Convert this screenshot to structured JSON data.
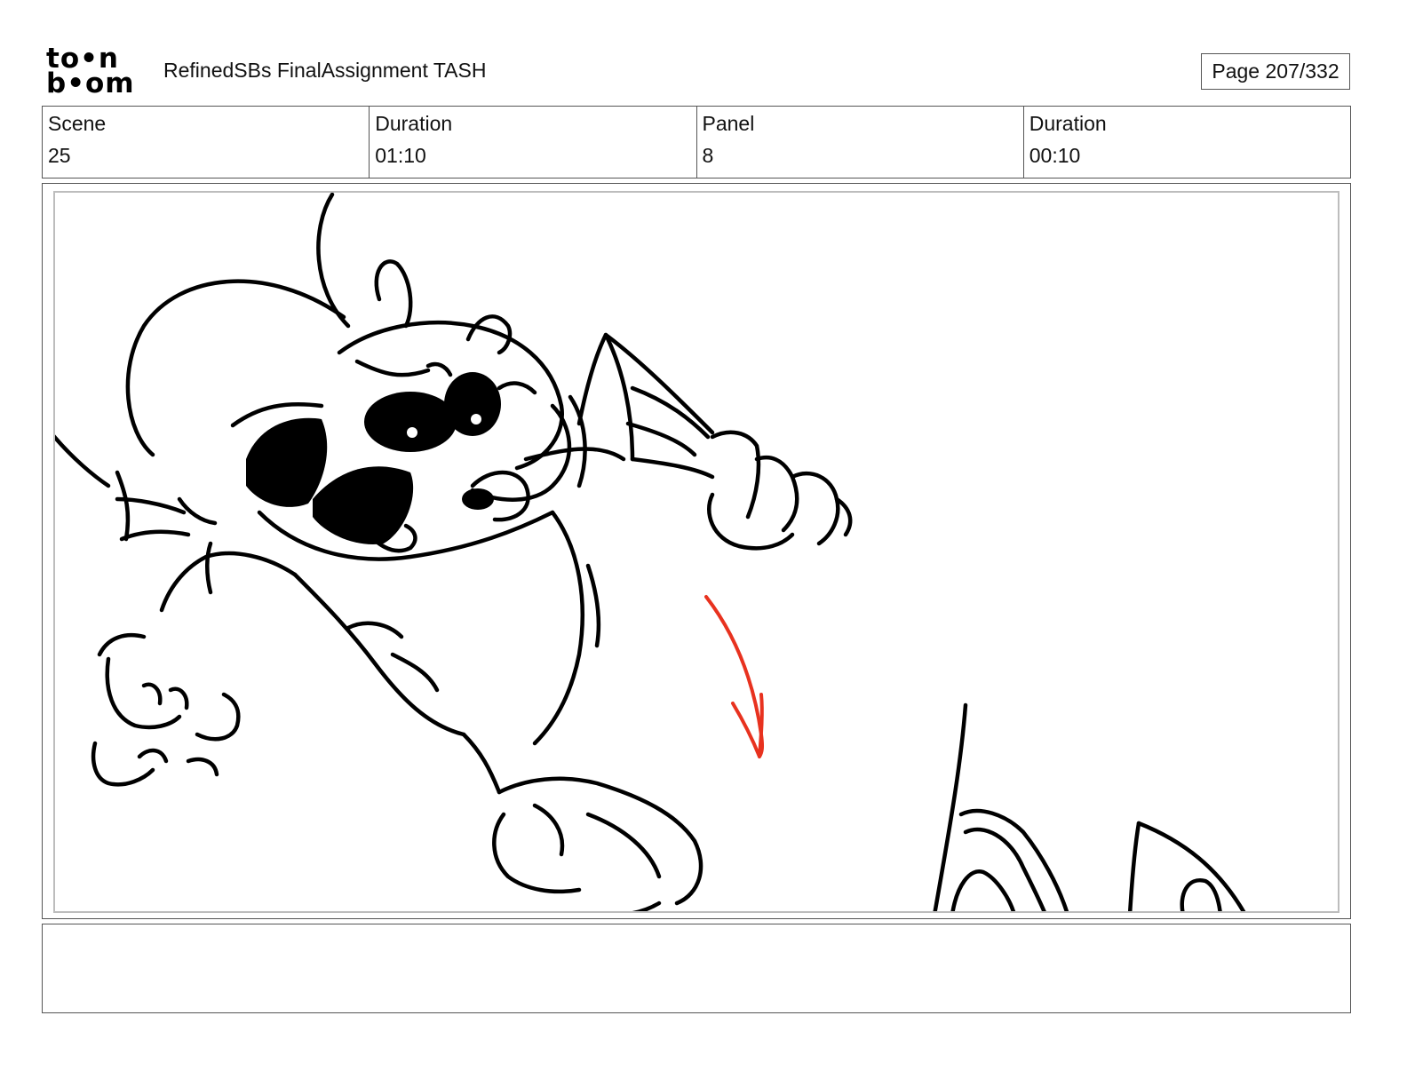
{
  "header": {
    "logo_line1": "to•n",
    "logo_line2": "b•om",
    "document_title": "RefinedSBs FinalAssignment TASH",
    "page_indicator": "Page 207/332"
  },
  "info": {
    "scene_label": "Scene",
    "scene_value": "25",
    "scene_duration_label": "Duration",
    "scene_duration_value": "01:10",
    "panel_label": "Panel",
    "panel_value": "8",
    "panel_duration_label": "Duration",
    "panel_duration_value": "00:10"
  },
  "panel": {
    "drawing": "rough storyboard sketch of a cartoon character",
    "line_color": "#000000",
    "arrow_color": "#e8321f"
  },
  "notes": {
    "text": ""
  }
}
